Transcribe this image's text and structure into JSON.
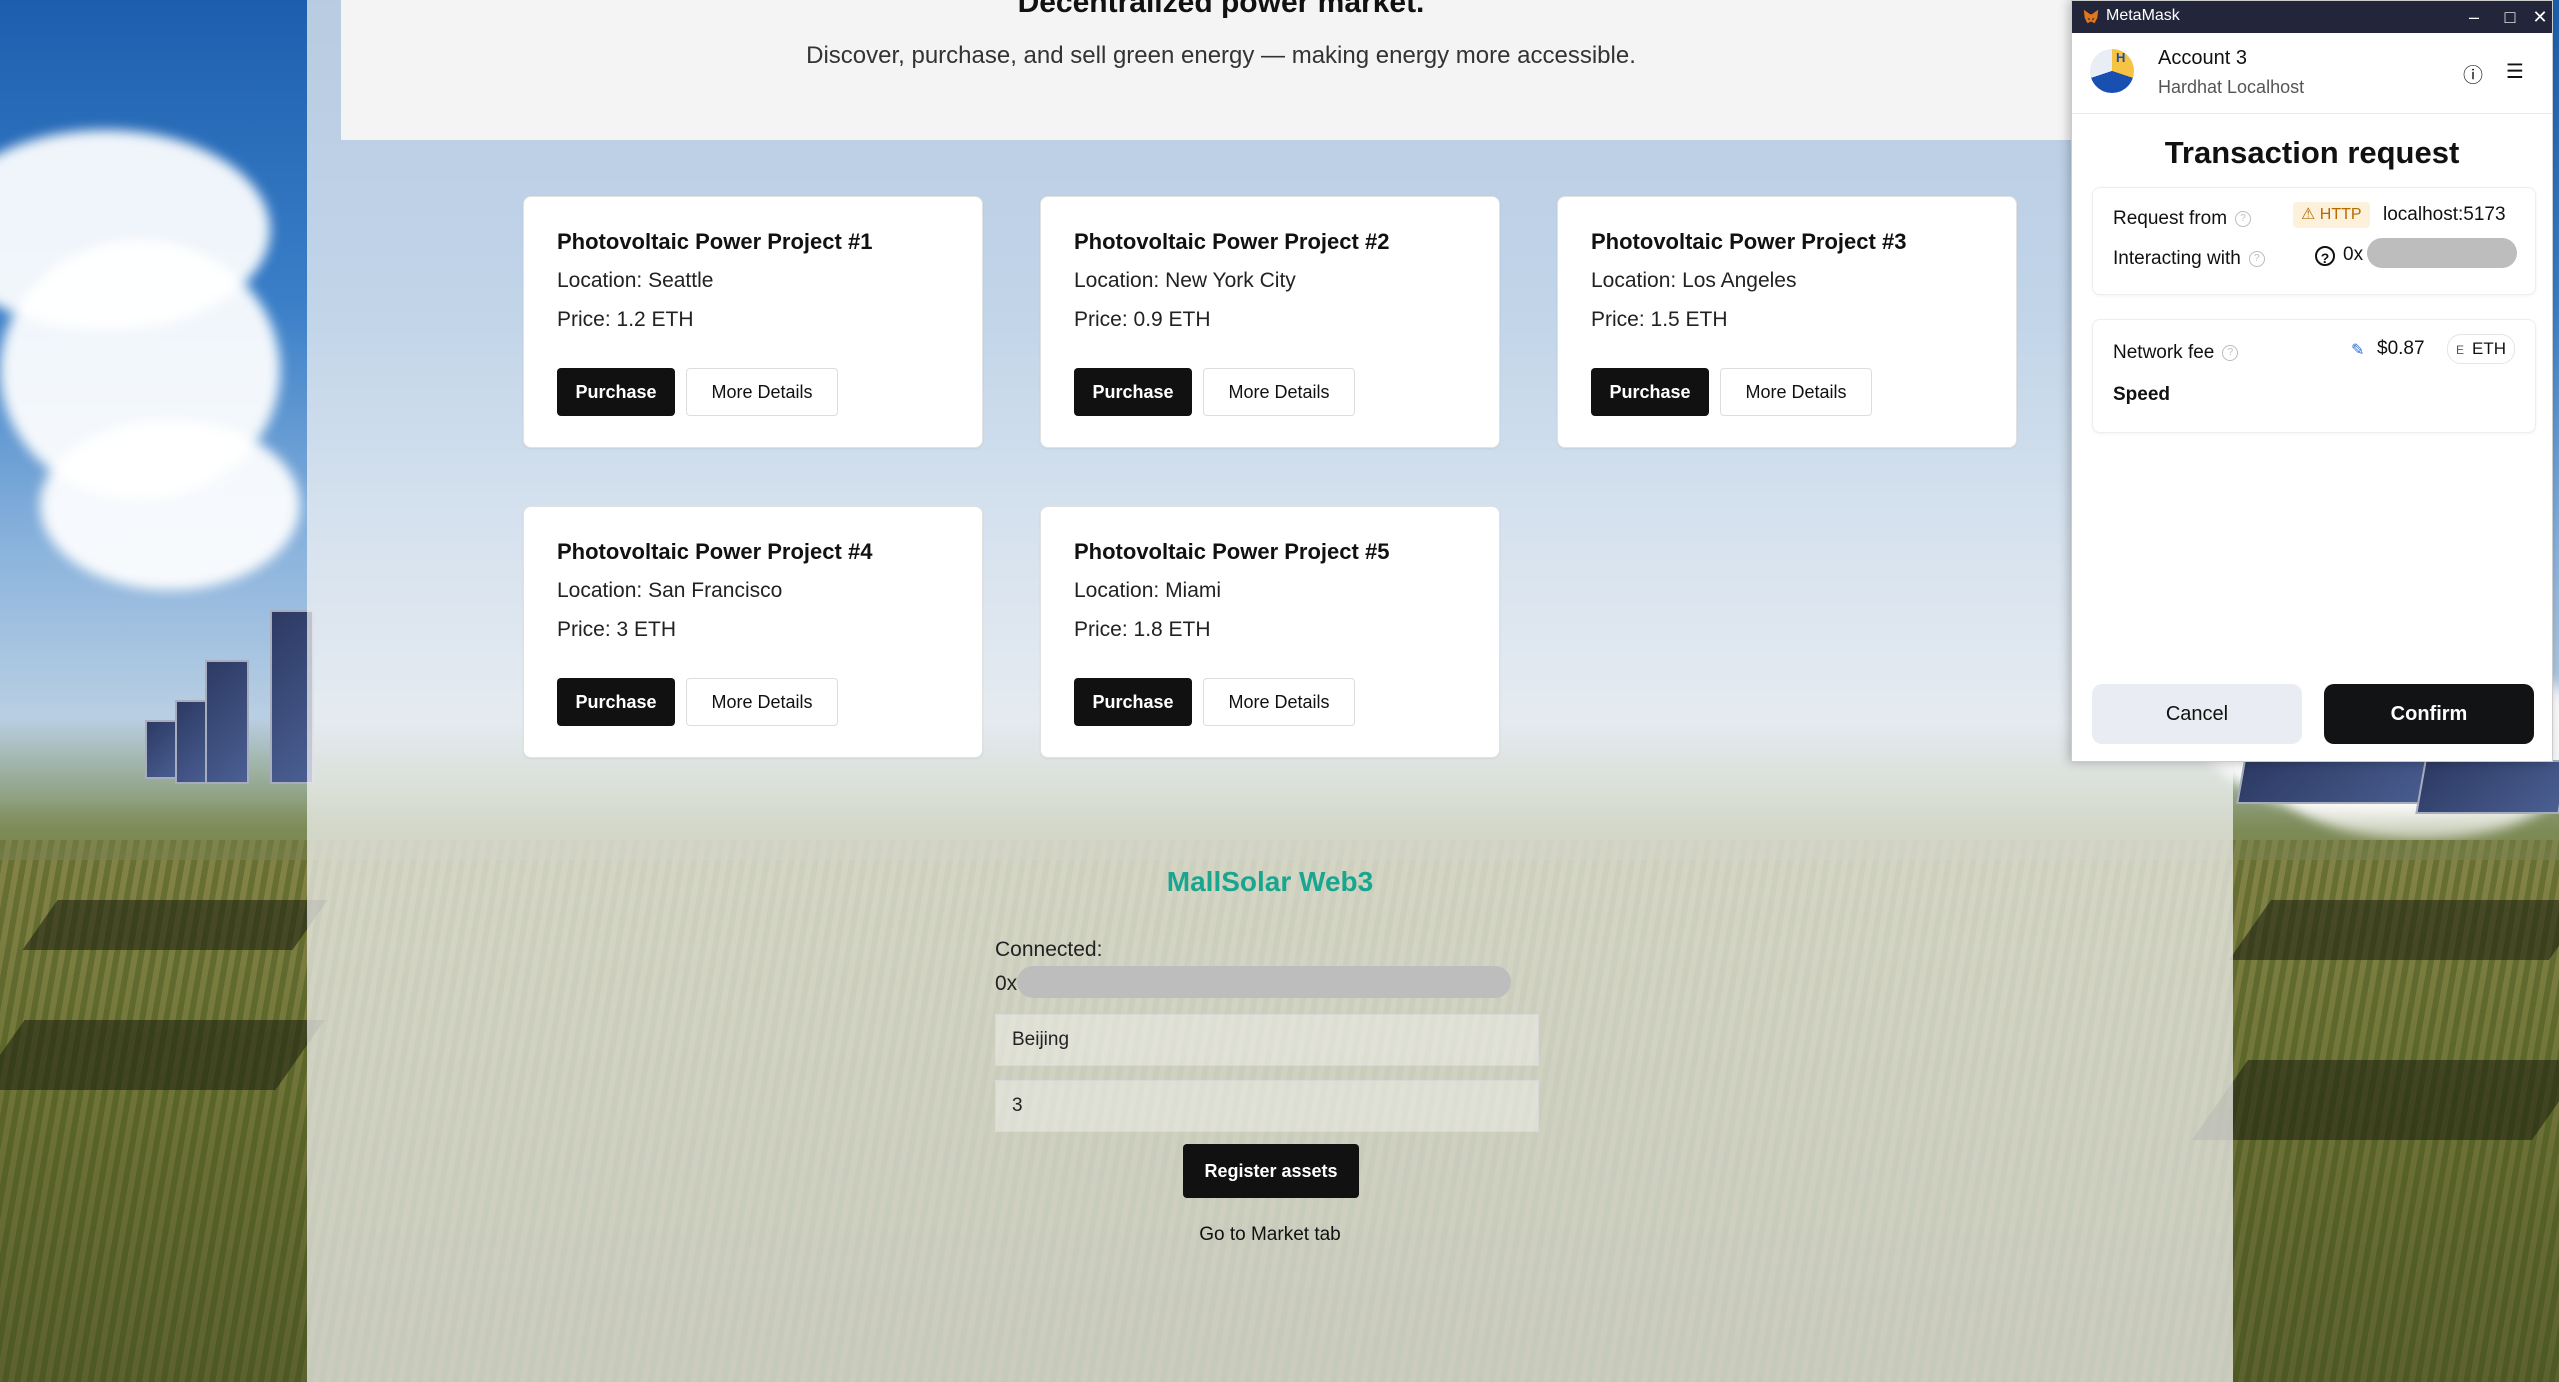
{
  "page": {
    "hero_title": "Decentralized power market.",
    "hero_subtitle": "Discover, purchase, and sell green energy — making energy more accessible."
  },
  "projects": [
    {
      "title": "Photovoltaic Power Project #1",
      "location": "Location: Seattle",
      "price": "Price: 1.2 ETH",
      "purchase_label": "Purchase",
      "details_label": "More Details"
    },
    {
      "title": "Photovoltaic Power Project #2",
      "location": "Location: New York City",
      "price": "Price: 0.9 ETH",
      "purchase_label": "Purchase",
      "details_label": "More Details"
    },
    {
      "title": "Photovoltaic Power Project #3",
      "location": "Location: Los Angeles",
      "price": "Price: 1.5 ETH",
      "purchase_label": "Purchase",
      "details_label": "More Details"
    },
    {
      "title": "Photovoltaic Power Project #4",
      "location": "Location: San Francisco",
      "price": "Price: 3 ETH",
      "purchase_label": "Purchase",
      "details_label": "More Details"
    },
    {
      "title": "Photovoltaic Power Project #5",
      "location": "Location: Miami",
      "price": "Price: 1.8 ETH",
      "purchase_label": "Purchase",
      "details_label": "More Details"
    }
  ],
  "register": {
    "brand": "MallSolar Web3",
    "connected_label": "Connected:",
    "connected_address_prefix": "0x",
    "location_value": "Beijing",
    "price_value": "3",
    "register_label": "Register assets",
    "market_link": "Go to Market tab"
  },
  "metamask": {
    "window_title": "MetaMask",
    "account_name": "Account 3",
    "network": "Hardhat Localhost",
    "avatar_letter": "H",
    "title": "Transaction request",
    "request_from_label": "Request from",
    "http_badge": "HTTP",
    "request_from_host": "localhost:5173",
    "interacting_with_label": "Interacting with",
    "interacting_address_prefix": "0x",
    "network_fee_label": "Network fee",
    "network_fee_value": "$0.87",
    "fee_currency": "ETH",
    "fee_currency_icon": "E",
    "speed_label": "Speed",
    "cancel_label": "Cancel",
    "confirm_label": "Confirm"
  },
  "colors": {
    "accent_teal": "#19a68f",
    "button_dark": "#111111",
    "mm_titlebar": "#23263a"
  }
}
